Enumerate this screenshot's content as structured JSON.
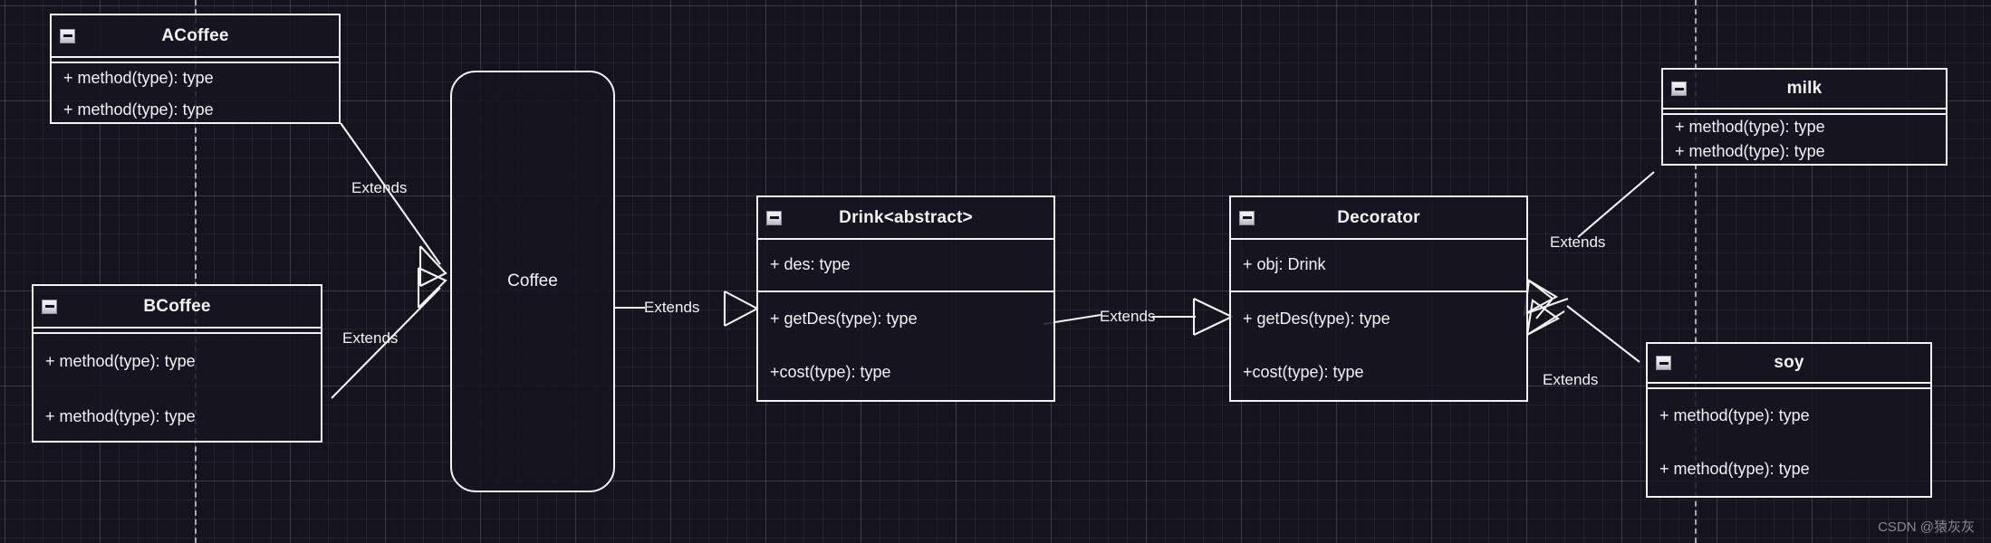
{
  "diagram": {
    "title": "Coffee decorator UML class diagram",
    "watermark": "CSDN @猿灰灰",
    "colors": {
      "background": "#15141d",
      "stroke": "#f2f2f5",
      "grid_minor": "rgba(255,255,255,0.055)",
      "grid_major": "rgba(255,255,255,0.115)",
      "watermark": "#9a9aa6"
    },
    "icon_name": "collapse-minus-icon"
  },
  "classes": [
    {
      "id": "acoffee",
      "name": "ACoffee",
      "icon": "collapse-minus-icon",
      "attributes": [],
      "methods": [
        "+ method(type): type",
        "+ method(type): type"
      ]
    },
    {
      "id": "bcoffee",
      "name": "BCoffee",
      "icon": "collapse-minus-icon",
      "attributes": [],
      "methods": [
        "+ method(type): type",
        "+ method(type): type"
      ]
    },
    {
      "id": "drink",
      "name": "Drink<abstract>",
      "icon": "collapse-minus-icon",
      "attributes": [
        "+ des: type"
      ],
      "methods": [
        "+ getDes(type): type",
        "+cost(type): type"
      ]
    },
    {
      "id": "decorator",
      "name": "Decorator",
      "icon": "collapse-minus-icon",
      "attributes": [
        "+ obj: Drink"
      ],
      "methods": [
        "+ getDes(type): type",
        "+cost(type): type"
      ]
    },
    {
      "id": "milk",
      "name": "milk",
      "icon": "collapse-minus-icon",
      "attributes": [],
      "methods": [
        "+ method(type): type",
        "+ method(type): type"
      ]
    },
    {
      "id": "soy",
      "name": "soy",
      "icon": "collapse-minus-icon",
      "attributes": [],
      "methods": [
        "+ method(type): type",
        "+ method(type): type"
      ]
    }
  ],
  "nodes": [
    {
      "id": "coffee",
      "label": "Coffee",
      "shape": "rounded-rectangle"
    }
  ],
  "relations": [
    {
      "id": "acoffee-coffee",
      "label": "Extends",
      "from": "ACoffee",
      "to": "Coffee"
    },
    {
      "id": "bcoffee-coffee",
      "label": "Extends",
      "from": "BCoffee",
      "to": "Coffee"
    },
    {
      "id": "coffee-drink",
      "label": "Extends",
      "from": "Coffee",
      "to": "Drink<abstract>"
    },
    {
      "id": "drink-decorator",
      "label": "Extends",
      "from": "Drink<abstract>",
      "to": "Decorator"
    },
    {
      "id": "milk-decorator",
      "label": "Extends",
      "from": "milk",
      "to": "Decorator"
    },
    {
      "id": "soy-decorator",
      "label": "Extends",
      "from": "soy",
      "to": "Decorator"
    }
  ]
}
